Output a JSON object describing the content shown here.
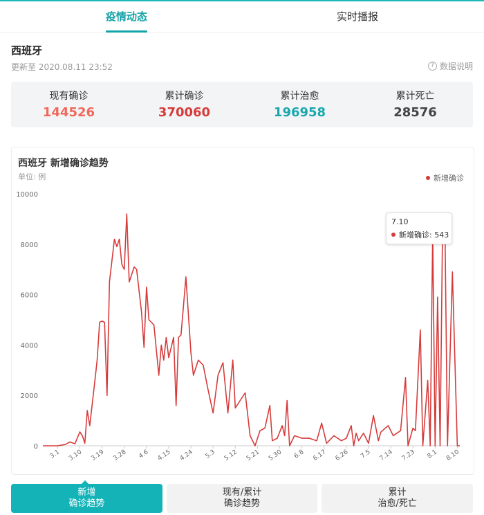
{
  "tabs": [
    {
      "label": "疫情动态",
      "active": true
    },
    {
      "label": "实时播报",
      "active": false
    }
  ],
  "region": "西班牙",
  "updated": "更新至 2020.08.11 23:52",
  "explain_label": "数据说明",
  "explain_icon": "question-circle-icon",
  "summary": [
    {
      "label": "现有确诊",
      "value": "144526",
      "color": "#f0685a"
    },
    {
      "label": "累计确诊",
      "value": "370060",
      "color": "#d63b3b"
    },
    {
      "label": "累计治愈",
      "value": "196958",
      "color": "#19a8ad"
    },
    {
      "label": "累计死亡",
      "value": "28576",
      "color": "#444444"
    }
  ],
  "chart": {
    "title": "西班牙 新增确诊趋势",
    "unit": "单位: 例",
    "legend": "新增确诊",
    "line_color": "#d63b3b"
  },
  "tooltip": {
    "date": "7.10",
    "text": "新增确诊: 543"
  },
  "chart_data": {
    "type": "line",
    "title": "西班牙 新增确诊趋势",
    "ylabel": "单位: 例",
    "ylim": [
      0,
      10000
    ],
    "yticks": [
      0,
      2000,
      4000,
      6000,
      8000,
      10000
    ],
    "xticks": [
      "3.1",
      "3.10",
      "3.19",
      "3.28",
      "4.6",
      "4.15",
      "4.24",
      "5.3",
      "5.12",
      "5.21",
      "5.30",
      "6.8",
      "6.17",
      "6.26",
      "7.5",
      "7.14",
      "7.23",
      "8.1",
      "8.10"
    ],
    "legend": "top-right",
    "grid": false,
    "series": [
      {
        "name": "新增确诊",
        "x_start": "2020-02-24",
        "x_end": "2020-08-11",
        "points": [
          [
            "2.24",
            0
          ],
          [
            "3.1",
            0
          ],
          [
            "3.4",
            50
          ],
          [
            "3.6",
            150
          ],
          [
            "3.8",
            80
          ],
          [
            "3.10",
            550
          ],
          [
            "3.11",
            400
          ],
          [
            "3.12",
            100
          ],
          [
            "3.13",
            1400
          ],
          [
            "3.14",
            800
          ],
          [
            "3.16",
            2500
          ],
          [
            "3.17",
            3400
          ],
          [
            "3.18",
            4900
          ],
          [
            "3.19",
            4950
          ],
          [
            "3.20",
            4900
          ],
          [
            "3.21",
            2000
          ],
          [
            "3.22",
            6500
          ],
          [
            "3.24",
            8200
          ],
          [
            "3.25",
            7900
          ],
          [
            "3.26",
            8200
          ],
          [
            "3.27",
            7200
          ],
          [
            "3.28",
            7000
          ],
          [
            "3.29",
            9200
          ],
          [
            "3.30",
            6500
          ],
          [
            "4.1",
            7100
          ],
          [
            "4.2",
            7000
          ],
          [
            "4.4",
            5300
          ],
          [
            "4.5",
            3900
          ],
          [
            "4.6",
            6300
          ],
          [
            "4.7",
            5000
          ],
          [
            "4.9",
            4800
          ],
          [
            "4.11",
            2800
          ],
          [
            "4.12",
            4000
          ],
          [
            "4.13",
            3400
          ],
          [
            "4.14",
            4300
          ],
          [
            "4.15",
            3500
          ],
          [
            "4.17",
            4300
          ],
          [
            "4.18",
            1600
          ],
          [
            "4.19",
            4300
          ],
          [
            "4.20",
            4400
          ],
          [
            "4.22",
            6700
          ],
          [
            "4.24",
            3700
          ],
          [
            "4.25",
            2800
          ],
          [
            "4.27",
            3400
          ],
          [
            "4.29",
            3200
          ],
          [
            "5.1",
            2200
          ],
          [
            "5.3",
            1300
          ],
          [
            "5.5",
            2800
          ],
          [
            "5.7",
            3300
          ],
          [
            "5.9",
            1300
          ],
          [
            "5.11",
            3400
          ],
          [
            "5.12",
            1500
          ],
          [
            "5.14",
            1800
          ],
          [
            "5.16",
            2100
          ],
          [
            "5.18",
            400
          ],
          [
            "5.20",
            0
          ],
          [
            "5.22",
            600
          ],
          [
            "5.24",
            700
          ],
          [
            "5.26",
            1600
          ],
          [
            "5.27",
            200
          ],
          [
            "5.29",
            300
          ],
          [
            "5.31",
            800
          ],
          [
            "6.1",
            400
          ],
          [
            "6.2",
            1800
          ],
          [
            "6.3",
            0
          ],
          [
            "6.5",
            400
          ],
          [
            "6.8",
            300
          ],
          [
            "6.11",
            300
          ],
          [
            "6.14",
            200
          ],
          [
            "6.16",
            900
          ],
          [
            "6.18",
            100
          ],
          [
            "6.21",
            400
          ],
          [
            "6.24",
            200
          ],
          [
            "6.26",
            300
          ],
          [
            "6.28",
            800
          ],
          [
            "6.29",
            0
          ],
          [
            "6.30",
            500
          ],
          [
            "7.1",
            200
          ],
          [
            "7.3",
            500
          ],
          [
            "7.5",
            100
          ],
          [
            "7.7",
            1200
          ],
          [
            "7.9",
            200
          ],
          [
            "7.10",
            543
          ],
          [
            "7.13",
            800
          ],
          [
            "7.15",
            400
          ],
          [
            "7.18",
            600
          ],
          [
            "7.20",
            2700
          ],
          [
            "7.21",
            0
          ],
          [
            "7.23",
            700
          ],
          [
            "7.24",
            600
          ],
          [
            "7.26",
            4600
          ],
          [
            "7.27",
            0
          ],
          [
            "7.29",
            2600
          ],
          [
            "7.30",
            0
          ],
          [
            "7.31",
            8500
          ],
          [
            "8.1",
            0
          ],
          [
            "8.2",
            5900
          ],
          [
            "8.3",
            0
          ],
          [
            "8.4",
            8500
          ],
          [
            "8.5",
            8500
          ],
          [
            "8.6",
            0
          ],
          [
            "8.8",
            6900
          ],
          [
            "8.10",
            0
          ],
          [
            "8.11",
            0
          ]
        ]
      }
    ]
  },
  "buttons": [
    {
      "line1": "新增",
      "line2": "确诊趋势",
      "active": true
    },
    {
      "line1": "现有/累计",
      "line2": "确诊趋势",
      "active": false
    },
    {
      "line1": "累计",
      "line2": "治愈/死亡",
      "active": false
    }
  ]
}
